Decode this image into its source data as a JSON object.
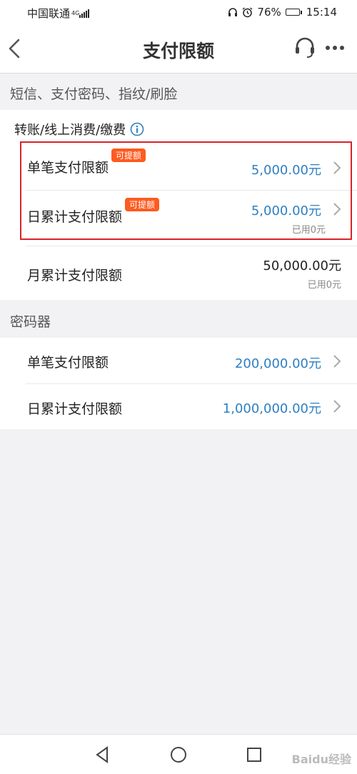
{
  "status_bar": {
    "carrier": "中国联通",
    "network": "4G",
    "battery": "76%",
    "battery_level": 0.76,
    "time": "15:14"
  },
  "header": {
    "title": "支付限额",
    "back_icon": "chevron-left-icon",
    "support_icon": "headset-icon",
    "more_icon": "more-dots-icon"
  },
  "sms_section": {
    "header": "短信、支付密码、指纹/刷脸",
    "sub_title": "转账/线上消费/缴费",
    "rows": [
      {
        "label": "单笔支付限额",
        "badge": "可提额",
        "value": "5,000.00元"
      },
      {
        "label": "日累计支付限额",
        "badge": "可提额",
        "value": "5,000.00元",
        "used": "已用0元"
      },
      {
        "label": "月累计支付限额",
        "value": "50,000.00元",
        "used": "已用0元"
      }
    ]
  },
  "token_section": {
    "header": "密码器",
    "rows": [
      {
        "label": "单笔支付限额",
        "value": "200,000.00元"
      },
      {
        "label": "日累计支付限额",
        "value": "1,000,000.00元"
      }
    ]
  },
  "colors": {
    "accent_blue": "#2e7fc1",
    "badge_orange": "#ff5a1f",
    "highlight_red": "#d8232a"
  },
  "watermark": "Baidu经验"
}
